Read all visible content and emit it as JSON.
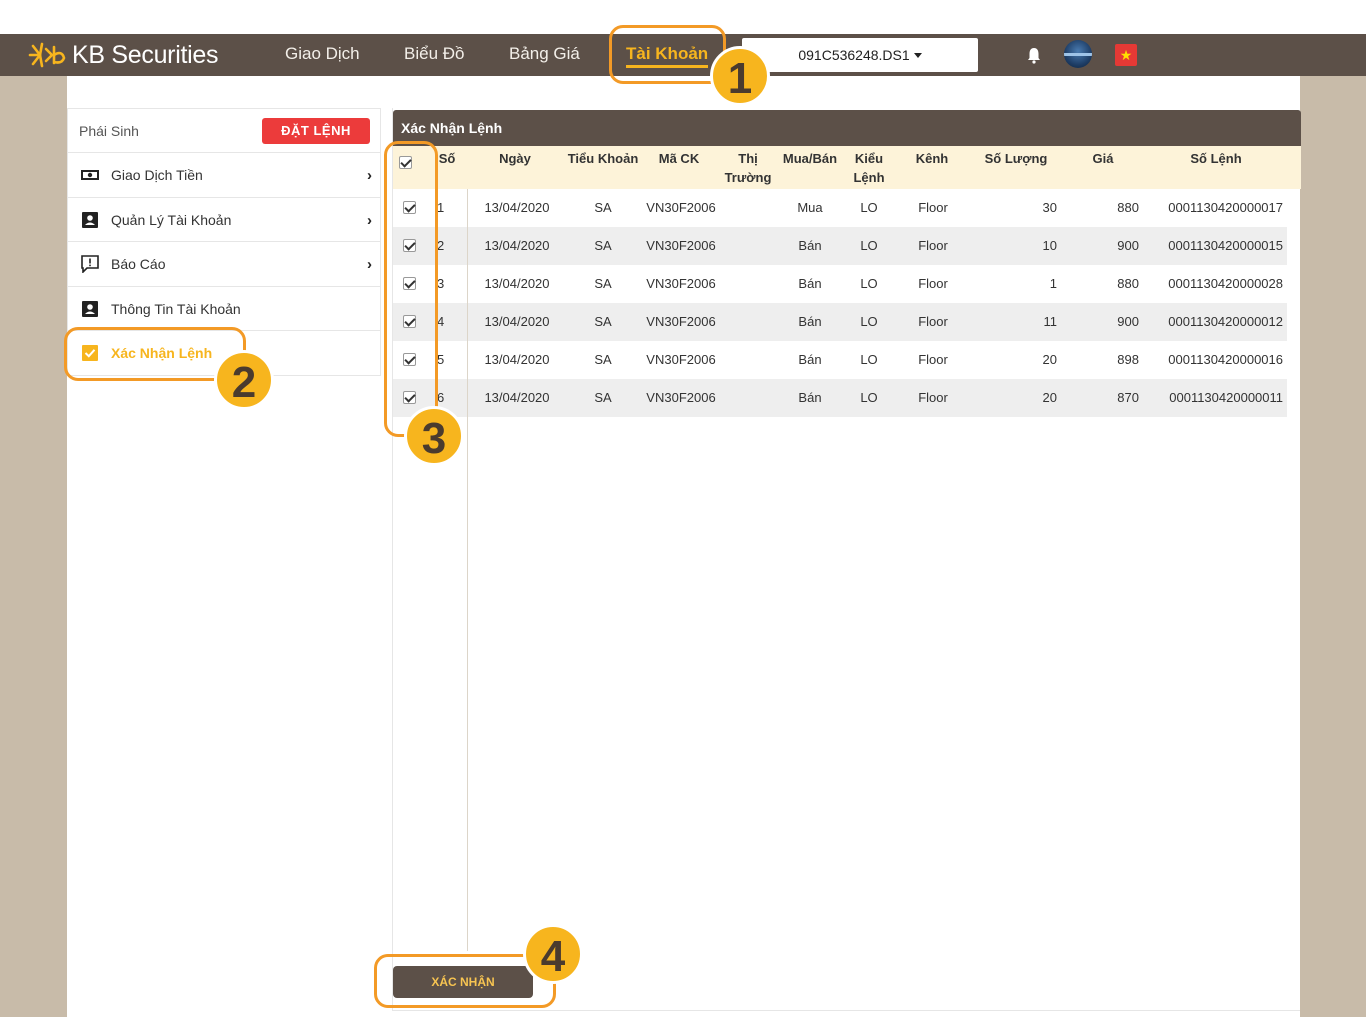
{
  "brand": {
    "name": "KB Securities"
  },
  "nav": {
    "items": [
      {
        "label": "Giao Dịch"
      },
      {
        "label": "Biểu Đồ"
      },
      {
        "label": "Bảng Giá"
      },
      {
        "label": "Tài Khoản"
      }
    ],
    "account": "091C536248.DS1"
  },
  "sidebar": {
    "title": "Phái Sinh",
    "order_button": "ĐẶT LỆNH",
    "items": [
      {
        "label": "Giao Dịch Tiền",
        "icon": "cash-icon"
      },
      {
        "label": "Quản Lý Tài Khoản",
        "icon": "account-card-icon"
      },
      {
        "label": "Báo Cáo",
        "icon": "report-icon"
      },
      {
        "label": "Thông Tin Tài Khoản",
        "icon": "account-info-icon"
      },
      {
        "label": "Xác Nhận Lệnh",
        "icon": "checkbox-icon"
      }
    ]
  },
  "main": {
    "title": "Xác Nhận Lệnh",
    "headers": [
      "Số",
      "Ngày",
      "Tiểu Khoản",
      "Mã CK",
      "Thị Trường",
      "Mua/Bán",
      "Kiểu Lệnh",
      "Kênh",
      "Số Lượng",
      "Giá",
      "Số Lệnh"
    ],
    "rows": [
      [
        "1",
        "13/04/2020",
        "SA",
        "VN30F2006",
        "",
        "Mua",
        "LO",
        "Floor",
        "30",
        "880",
        "0001130420000017"
      ],
      [
        "2",
        "13/04/2020",
        "SA",
        "VN30F2006",
        "",
        "Bán",
        "LO",
        "Floor",
        "10",
        "900",
        "0001130420000015"
      ],
      [
        "3",
        "13/04/2020",
        "SA",
        "VN30F2006",
        "",
        "Bán",
        "LO",
        "Floor",
        "1",
        "880",
        "0001130420000028"
      ],
      [
        "4",
        "13/04/2020",
        "SA",
        "VN30F2006",
        "",
        "Bán",
        "LO",
        "Floor",
        "11",
        "900",
        "0001130420000012"
      ],
      [
        "5",
        "13/04/2020",
        "SA",
        "VN30F2006",
        "",
        "Bán",
        "LO",
        "Floor",
        "20",
        "898",
        "0001130420000016"
      ],
      [
        "6",
        "13/04/2020",
        "SA",
        "VN30F2006",
        "",
        "Bán",
        "LO",
        "Floor",
        "20",
        "870",
        "0001130420000011"
      ]
    ],
    "confirm_button": "XÁC NHẬN"
  },
  "callouts": [
    "1",
    "2",
    "3",
    "4"
  ],
  "colors": {
    "brand_bar": "#5c5048",
    "accent": "#f7b51e",
    "danger": "#ec3b3b",
    "header_row": "#fdf3d9"
  }
}
